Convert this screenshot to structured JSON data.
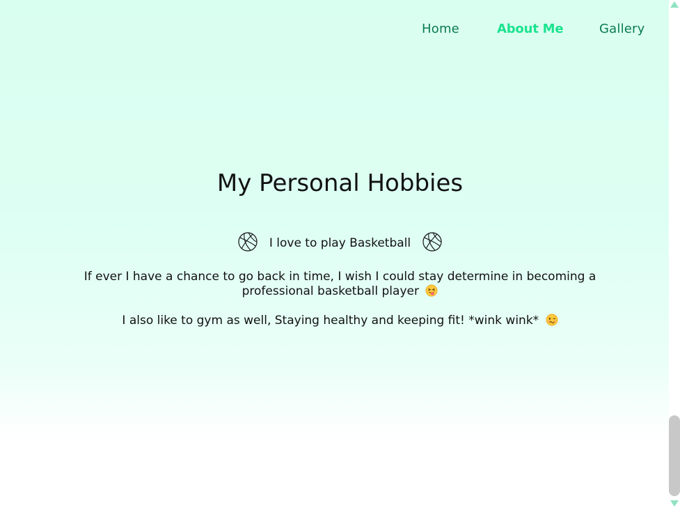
{
  "nav": {
    "home_label": "Home",
    "about_label": "About Me",
    "gallery_label": "Gallery"
  },
  "main": {
    "title": "My Personal Hobbies",
    "basketball_line": "I love to play Basketball",
    "paragraph1": "If ever I have a chance to go back in time, I wish I could stay determine in becoming a professional basketball player",
    "paragraph2": "I also like to gym as well, Staying healthy and keeping fit! *wink wink*"
  },
  "icons": {
    "basketball": "basketball-icon",
    "tongue_emoji": "winking-face-with-tongue-emoji",
    "woozy_emoji": "woozy-face-emoji"
  },
  "colors": {
    "active_nav": "#1be38f",
    "nav": "#0b7a52",
    "background_top": "#d9fff0",
    "scroll_arrow": "#8fe3c1"
  }
}
